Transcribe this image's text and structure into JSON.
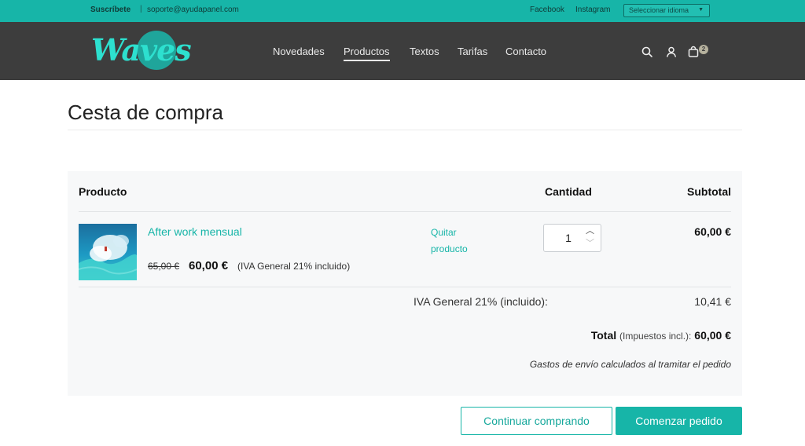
{
  "topbar": {
    "subscribe": "Suscríbete",
    "separator": "|",
    "email": "soporte@ayudapanel.com",
    "facebook": "Facebook",
    "instagram": "Instagram",
    "language_select": "Seleccionar idioma"
  },
  "header": {
    "logo_text": "Waves",
    "nav": [
      "Novedades",
      "Productos",
      "Textos",
      "Tarifas",
      "Contacto"
    ],
    "active_nav": "Productos",
    "icons": [
      "search-icon",
      "user-icon",
      "cart-icon"
    ],
    "cart_count": "2"
  },
  "page": {
    "title": "Cesta de compra"
  },
  "cart": {
    "headers": {
      "product": "Producto",
      "quantity": "Cantidad",
      "subtotal": "Subtotal"
    },
    "items": [
      {
        "name": "After work mensual",
        "old_price": "65,00 €",
        "price": "60,00 €",
        "tax_note": "(IVA General 21% incluido)",
        "remove_label": "Quitar producto",
        "quantity": "1",
        "subtotal": "60,00 €"
      }
    ],
    "iva_label": "IVA General 21% (incluido):",
    "iva_value": "10,41 €",
    "total_label": "Total",
    "total_incl": "(Impuestos incl.):",
    "total_value": "60,00 €",
    "shipping_note": "Gastos de envío calculados al tramitar el pedido"
  },
  "actions": {
    "continue": "Continuar comprando",
    "checkout": "Comenzar pedido"
  },
  "colors": {
    "accent": "#17b5a8",
    "header_bg": "#3d3d3d",
    "panel_bg": "#f7f8f9"
  }
}
